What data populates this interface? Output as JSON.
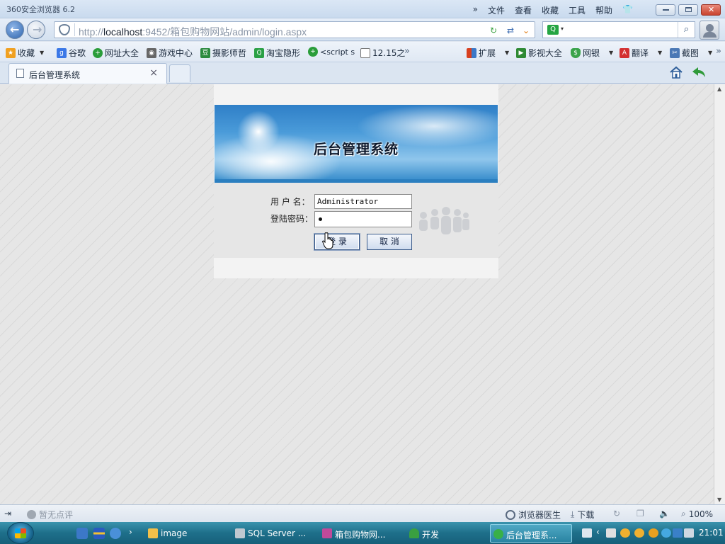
{
  "window": {
    "title": "360安全浏览器 6.2",
    "menu": [
      "文件",
      "查看",
      "收藏",
      "工具",
      "帮助"
    ]
  },
  "navigation": {
    "address_protocol": "http://",
    "address_host": "localhost",
    "address_rest": ":9452/箱包购物网站/admin/login.aspx",
    "search_value": ""
  },
  "bookmarks": {
    "items": [
      {
        "label": "收藏",
        "icon": "star-icon",
        "color": "#f0a020"
      },
      {
        "label": "谷歌",
        "icon": "google-icon",
        "color": "#3b78e7"
      },
      {
        "label": "网址大全",
        "icon": "360-icon",
        "color": "#2a9d3a"
      },
      {
        "label": "游戏中心",
        "icon": "gamepad-icon",
        "color": "#555555"
      },
      {
        "label": "摄影师哲",
        "icon": "douban-icon",
        "color": "#2b8a3e"
      },
      {
        "label": "淘宝隐形",
        "icon": "search-icon",
        "color": "#2aa045"
      },
      {
        "label": "<script s",
        "icon": "360-icon",
        "color": "#2a9d3a"
      },
      {
        "label": "12.15之",
        "icon": "page-icon",
        "color": "#888888"
      }
    ],
    "right_items": [
      {
        "label": "扩展",
        "icon": "apps-icon",
        "color": "#d8401f"
      },
      {
        "label": "影视大全",
        "icon": "video-icon",
        "color": "#2f8a34"
      },
      {
        "label": "网银",
        "icon": "bank-shield-icon",
        "color": "#3aa34a"
      },
      {
        "label": "翻译",
        "icon": "translate-icon",
        "color": "#d32f2f"
      },
      {
        "label": "截图",
        "icon": "screenshot-icon",
        "color": "#4a78b5"
      }
    ]
  },
  "tabs": [
    {
      "title": "后台管理系统",
      "close": "×"
    }
  ],
  "login": {
    "banner_title": "后台管理系统",
    "username_label": "用 户 名：",
    "password_label": "登陆密码：",
    "username_value": "Administrator",
    "login_button": "登 录",
    "cancel_button": "取 消"
  },
  "statusbar": {
    "comment": "暂无点评",
    "doctor": "浏览器医生",
    "download": "下载",
    "zoom": "100%"
  },
  "taskbar": {
    "tasks": [
      {
        "label": "image",
        "icon": "folder-icon",
        "color": "#f3c04a"
      },
      {
        "label": "SQL Server ...",
        "icon": "sql-server-icon",
        "color": "#c0c8d0"
      },
      {
        "label": "箱包购物网...",
        "icon": "visual-studio-icon",
        "color": "#c04a9a"
      },
      {
        "label": "开发",
        "icon": "tree-icon",
        "color": "#3aa040"
      },
      {
        "label": "后台管理系...",
        "icon": "browser-360-icon",
        "color": "#38b048"
      }
    ],
    "clock": "21:01"
  },
  "colors": {
    "accent": "#2d64ad",
    "banner_blue": "#2f7fc7",
    "taskbar": "#1e6f8a"
  }
}
